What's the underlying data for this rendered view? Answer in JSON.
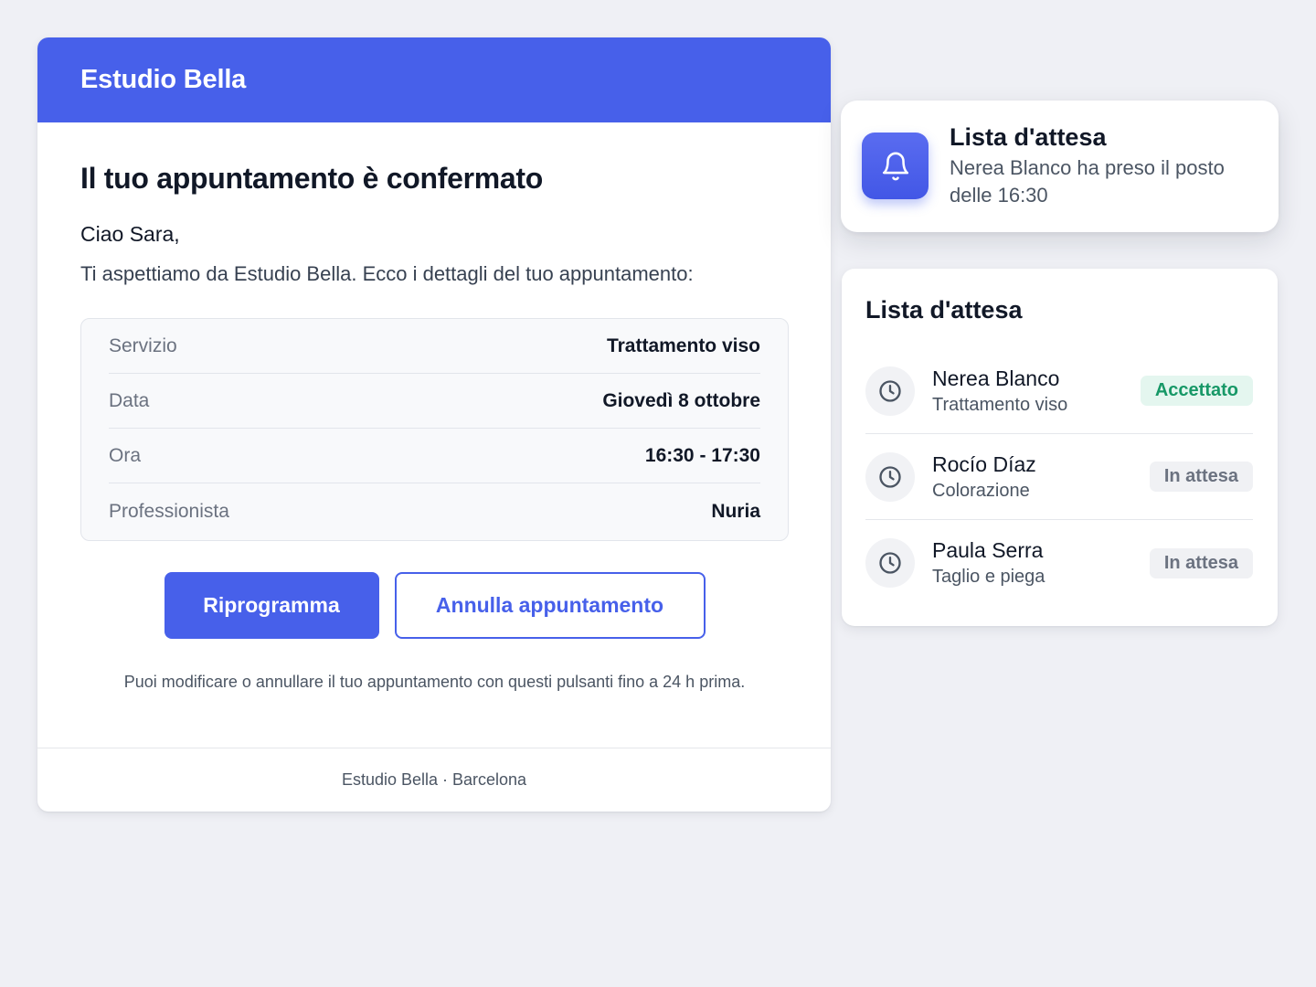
{
  "email": {
    "brand": "Estudio Bella",
    "title": "Il tuo appuntamento è confermato",
    "greeting": "Ciao Sara,",
    "intro": "Ti aspettiamo da Estudio Bella. Ecco i dettagli del tuo appuntamento:",
    "details": [
      {
        "label": "Servizio",
        "value": "Trattamento viso"
      },
      {
        "label": "Data",
        "value": "Giovedì 8 ottobre"
      },
      {
        "label": "Ora",
        "value": "16:30 - 17:30"
      },
      {
        "label": "Professionista",
        "value": "Nuria"
      }
    ],
    "reschedule_label": "Riprogramma",
    "cancel_label": "Annulla appuntamento",
    "hint": "Puoi modificare o annullare il tuo appuntamento con questi pulsanti fino a 24 h prima.",
    "footer": "Estudio Bella · Barcelona"
  },
  "notification": {
    "icon": "bell-icon",
    "title": "Lista d'attesa",
    "message": "Nerea Blanco ha preso il posto delle 16:30"
  },
  "waitlist": {
    "title": "Lista d'attesa",
    "items": [
      {
        "name": "Nerea Blanco",
        "service": "Trattamento viso",
        "status": "Accettato",
        "icon": "clock-icon"
      },
      {
        "name": "Rocío Díaz",
        "service": "Colorazione",
        "status": "In attesa",
        "icon": "clock-icon"
      },
      {
        "name": "Paula Serra",
        "service": "Taglio e piega",
        "status": "In attesa",
        "icon": "clock-icon"
      }
    ]
  },
  "colors": {
    "accent": "#4760ea",
    "background": "#eff0f5",
    "accepted_text": "#179867",
    "accepted_bg": "#e4f6ef",
    "waiting_text": "#6b7280",
    "waiting_bg": "#f0f1f4"
  }
}
